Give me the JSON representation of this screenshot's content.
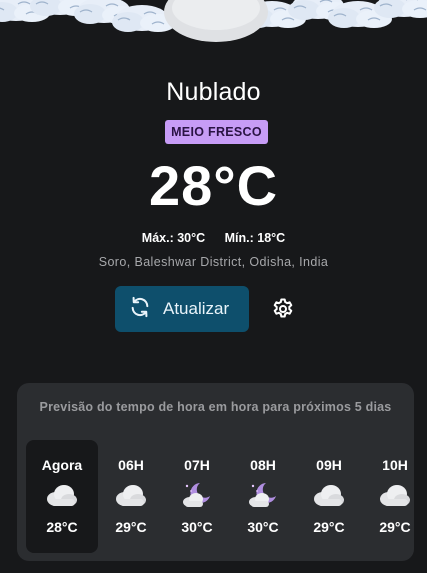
{
  "weather": {
    "condition": "Nublado",
    "feel_badge": "MEIO FRESCO",
    "temperature": "28°C",
    "max": "Máx.: 30°C",
    "min": "Mín.: 18°C",
    "location": "Soro, Baleshwar District, Odisha, India"
  },
  "actions": {
    "refresh_label": "Atualizar",
    "refresh_icon": "refresh-icon",
    "settings_icon": "gear-icon"
  },
  "forecast": {
    "title": "Previsão do tempo de hora em hora para próximos 5 dias",
    "hours": [
      {
        "time": "Agora",
        "temp": "28°C",
        "icon": "cloud-icon"
      },
      {
        "time": "06H",
        "temp": "29°C",
        "icon": "cloud-icon"
      },
      {
        "time": "07H",
        "temp": "30°C",
        "icon": "moon-cloud-icon"
      },
      {
        "time": "08H",
        "temp": "30°C",
        "icon": "moon-cloud-icon"
      },
      {
        "time": "09H",
        "temp": "29°C",
        "icon": "cloud-icon"
      },
      {
        "time": "10H",
        "temp": "29°C",
        "icon": "cloud-icon"
      }
    ]
  },
  "colors": {
    "background": "#17181a",
    "badge": "#c79cf6",
    "button": "#0e4f6c",
    "card": "#2b2d30"
  }
}
